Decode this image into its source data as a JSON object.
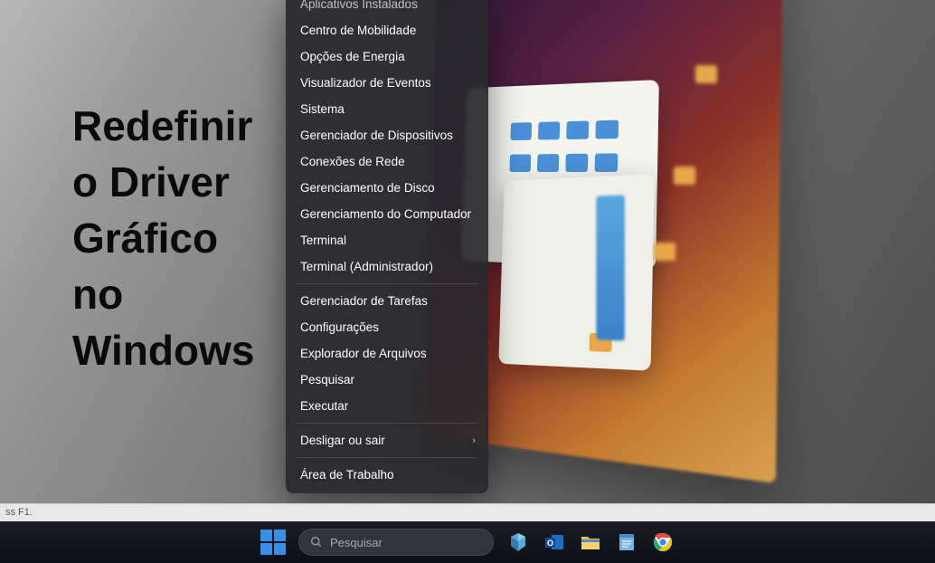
{
  "title_lines": [
    "Redefinir",
    "o Driver",
    "Gráfico",
    "no",
    "Windows"
  ],
  "hint_bar": "ss F1.",
  "winx_menu": {
    "groups": [
      {
        "items": [
          {
            "label": "Aplicativos Instalados",
            "cut": true
          },
          {
            "label": "Centro de Mobilidade"
          },
          {
            "label": "Opções de Energia"
          },
          {
            "label": "Visualizador de Eventos"
          },
          {
            "label": "Sistema"
          },
          {
            "label": "Gerenciador de Dispositivos"
          },
          {
            "label": "Conexões de Rede"
          },
          {
            "label": "Gerenciamento de Disco"
          },
          {
            "label": "Gerenciamento do Computador"
          },
          {
            "label": "Terminal"
          },
          {
            "label": "Terminal (Administrador)"
          }
        ]
      },
      {
        "items": [
          {
            "label": "Gerenciador de Tarefas"
          },
          {
            "label": "Configurações"
          },
          {
            "label": "Explorador de Arquivos"
          },
          {
            "label": "Pesquisar"
          },
          {
            "label": "Executar"
          }
        ]
      },
      {
        "items": [
          {
            "label": "Desligar ou sair",
            "submenu": true
          }
        ]
      },
      {
        "items": [
          {
            "label": "Área de Trabalho"
          }
        ]
      }
    ]
  },
  "taskbar": {
    "search_placeholder": "Pesquisar",
    "icons": [
      {
        "name": "copilot-icon"
      },
      {
        "name": "outlook-icon"
      },
      {
        "name": "file-explorer-icon"
      },
      {
        "name": "notepad-icon"
      },
      {
        "name": "chrome-icon"
      }
    ]
  }
}
